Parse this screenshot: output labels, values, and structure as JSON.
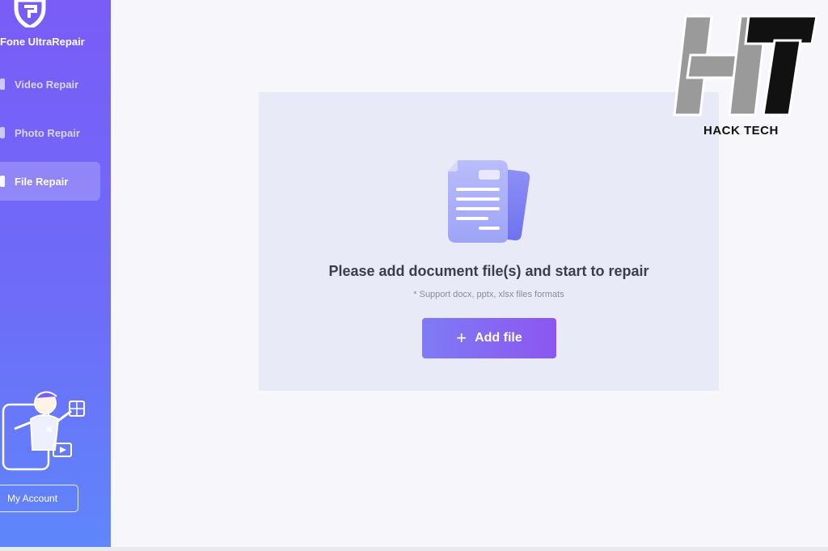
{
  "app": {
    "name": "Fone UltraRepair"
  },
  "sidebar": {
    "items": [
      {
        "label": "Video Repair",
        "icon": "video-icon",
        "active": false
      },
      {
        "label": "Photo Repair",
        "icon": "photo-icon",
        "active": false
      },
      {
        "label": "File Repair",
        "icon": "file-icon",
        "active": true
      }
    ],
    "account_label": "My Account"
  },
  "main": {
    "prompt_title": "Please add document file(s) and start to repair",
    "prompt_subtitle": "* Support docx, pptx, xlsx files formats",
    "add_button_label": "Add file",
    "add_button_icon": "plus-icon"
  },
  "watermark": {
    "text": "HACK TECH",
    "logo_letters": "HT"
  },
  "colors": {
    "sidebar_top": "#7a5cf7",
    "sidebar_bottom": "#5f86fb",
    "accent": "#8c56f0",
    "drop_zone": "#e9eaf8"
  }
}
